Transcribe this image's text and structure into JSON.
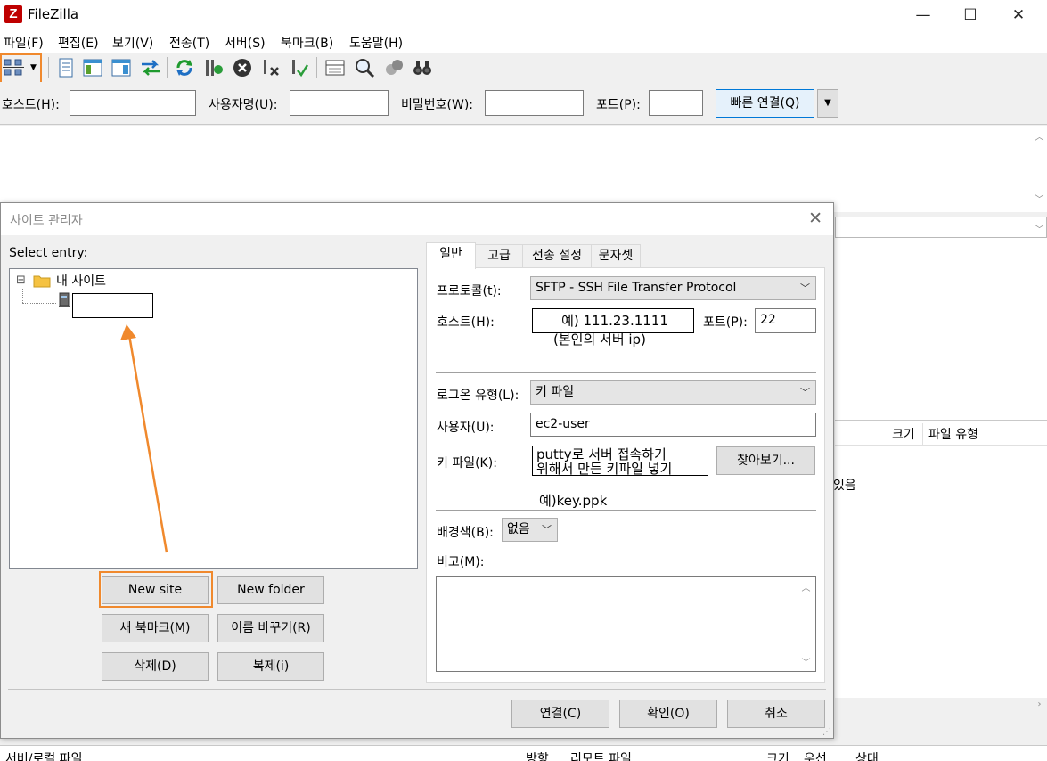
{
  "window": {
    "icon_letter": "Z",
    "title": "FileZilla",
    "minimize_glyph": "—",
    "maximize_glyph": "☐",
    "close_glyph": "✕"
  },
  "menu": [
    "파일(F)",
    "편집(E)",
    "보기(V)",
    "전송(T)",
    "서버(S)",
    "북마크(B)",
    "도움말(H)"
  ],
  "toolbar": {
    "icons": [
      "site-manager-icon",
      "message-log-icon",
      "local-tree-icon",
      "remote-tree-icon",
      "transfer-queue-icon",
      "refresh-icon",
      "process-queue-icon",
      "cancel-icon",
      "disconnect-icon",
      "reconnect-icon",
      "filter-icon",
      "compare-icon",
      "sync-browse-icon",
      "search-icon"
    ],
    "highlight_color": "#f0892d"
  },
  "quickconnect": {
    "host_label": "호스트(H):",
    "user_label": "사용자명(U):",
    "pass_label": "비밀번호(W):",
    "port_label": "포트(P):",
    "connect_label": "빠른 연결(Q)",
    "dropdown_glyph": "▼"
  },
  "background": {
    "col_size": "크기",
    "col_filetype": "파일 유형",
    "empty_text_fragment": "있음",
    "bottom_cols": [
      "서버/로컬 파일",
      "방향",
      "리모트 파일",
      "크기",
      "우선",
      "상태"
    ]
  },
  "site_manager": {
    "title": "사이트 관리자",
    "close_glyph": "✕",
    "select_entry_label": "Select entry:",
    "tree_root": "내 사이트",
    "tree_expander": "⊟",
    "buttons": {
      "new_site": "New site",
      "new_folder": "New folder",
      "new_bookmark": "새 북마크(M)",
      "rename": "이름 바꾸기(R)",
      "delete": "삭제(D)",
      "duplicate": "복제(i)",
      "connect": "연결(C)",
      "ok": "확인(O)",
      "cancel": "취소"
    },
    "tabs": [
      "일반",
      "고급",
      "전송 설정",
      "문자셋"
    ],
    "general": {
      "protocol_label": "프로토콜(t):",
      "protocol_value": "SFTP - SSH File Transfer Protocol",
      "host_label": "호스트(H):",
      "port_label": "포트(P):",
      "port_value": "22",
      "logon_label": "로그온 유형(L):",
      "logon_value": "키 파일",
      "user_label": "사용자(U):",
      "user_value": "ec2-user",
      "keyfile_label": "키 파일(K):",
      "browse_label": "찾아보기...",
      "bgcolor_label": "배경색(B):",
      "bgcolor_value": "없음",
      "comments_label": "비고(M):"
    },
    "annotations": {
      "host_hint_line1": "예) 111.23.1111",
      "host_hint_line2": "(본인의 서버 ip)",
      "key_hint_line1": "putty로 서버 접속하기",
      "key_hint_line2": "위해서 만든 키파일 넣기",
      "key_hint_example": "예)key.ppk",
      "arrow_color": "#f0892d"
    }
  }
}
